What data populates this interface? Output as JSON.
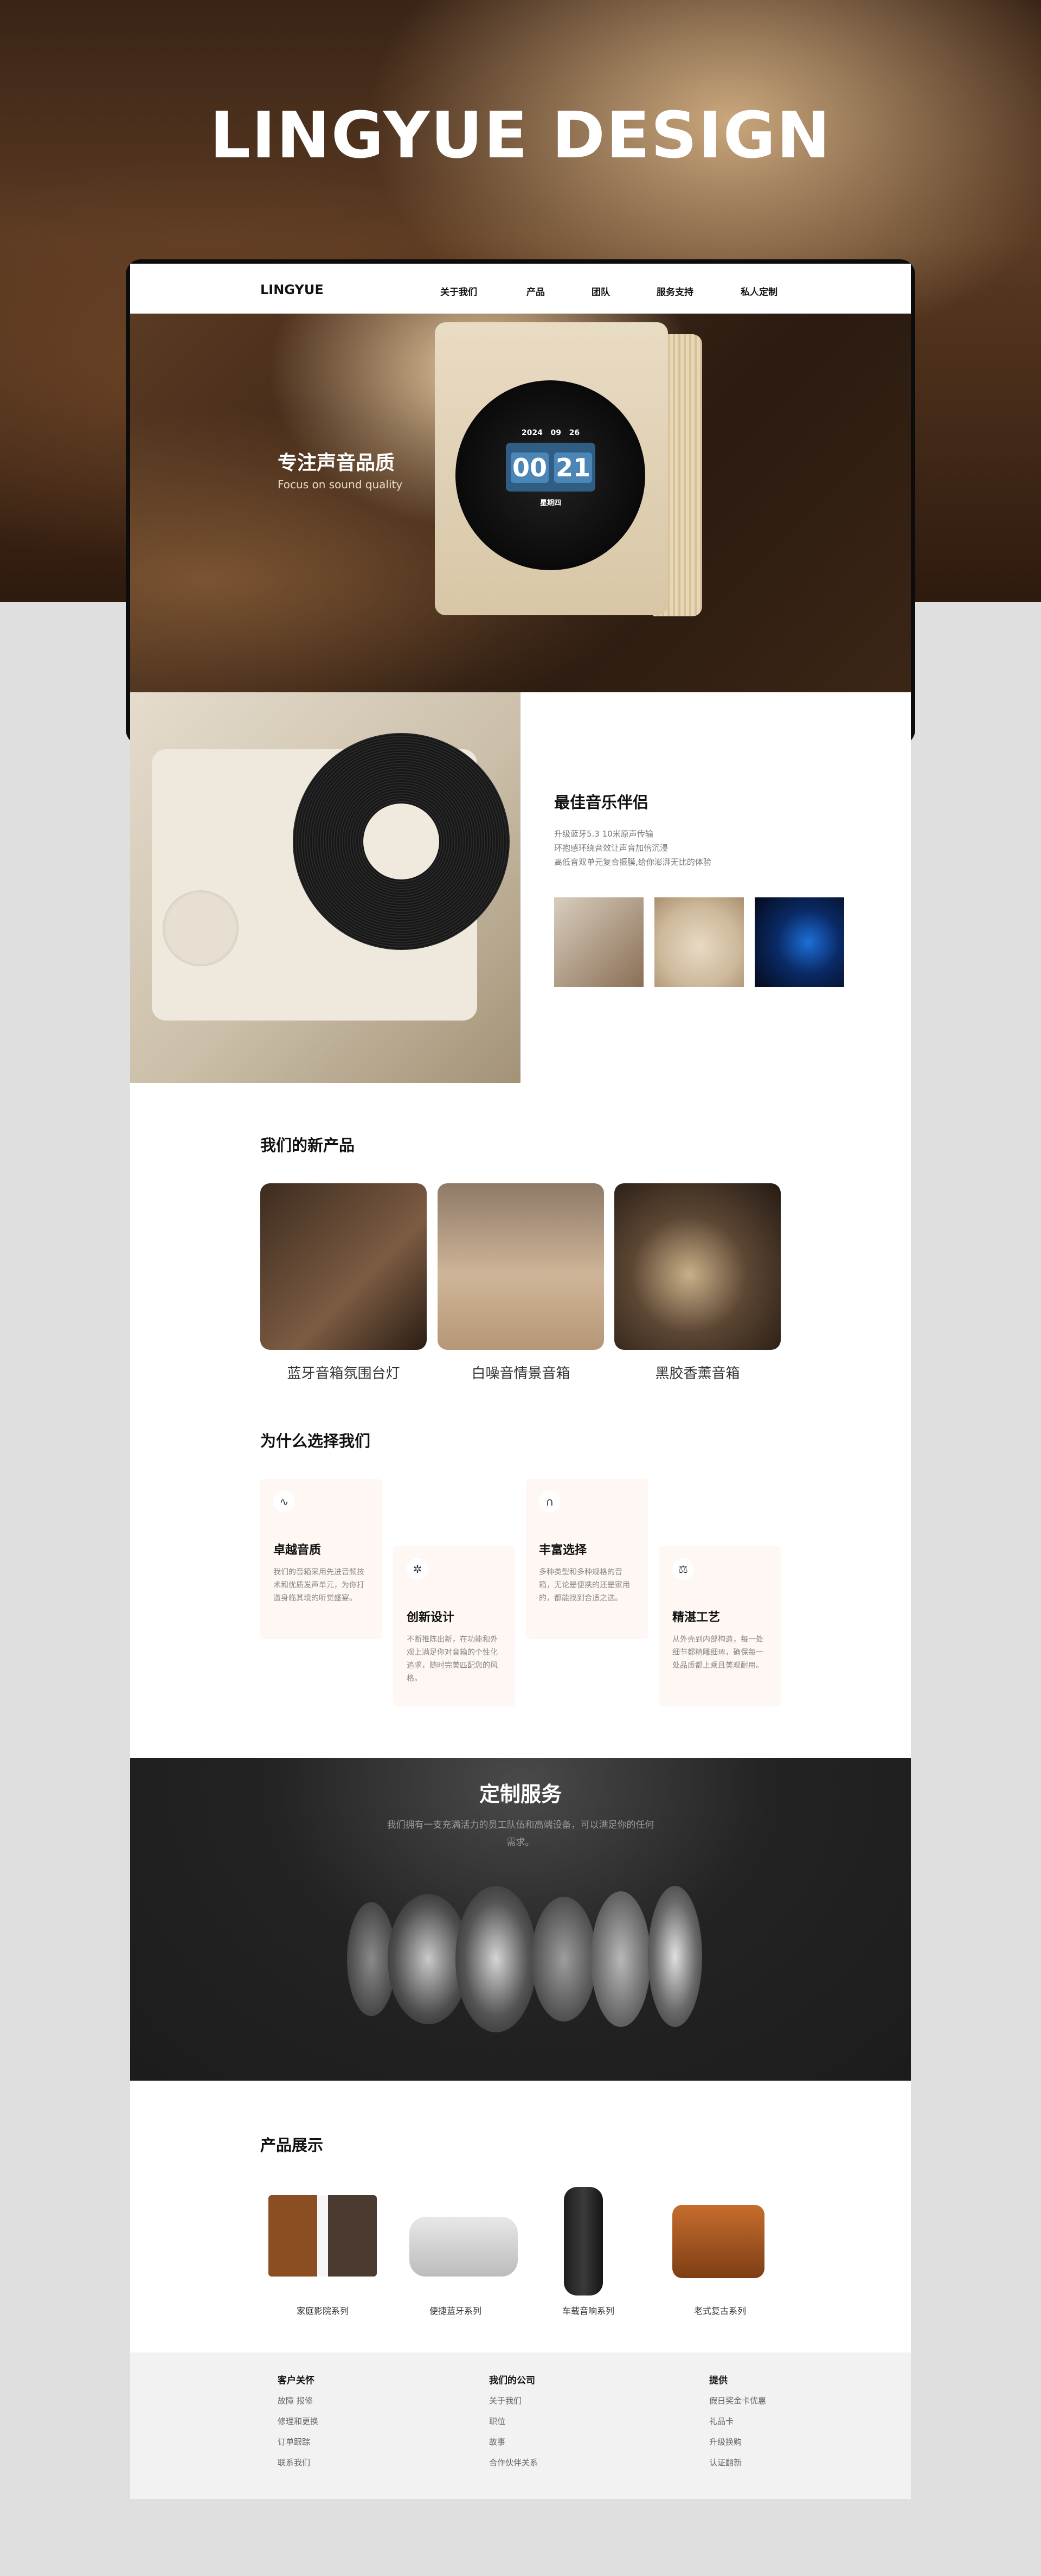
{
  "hero": {
    "title": "LINGYUE DESIGN"
  },
  "nav": {
    "logo": "LINGYUE",
    "items": [
      "关于我们",
      "产品",
      "团队",
      "服务支持",
      "私人定制"
    ]
  },
  "banner": {
    "title": "专注声音品质",
    "subtitle": "Focus on sound quality",
    "clock": {
      "year": "2024",
      "month": "09",
      "day": "26",
      "hour": "00",
      "minute": "21",
      "weekday": "星期四"
    }
  },
  "companion": {
    "title": "最佳音乐伴侣",
    "lines": [
      "升级蓝牙5.3 10米原声传输",
      "环抱感环绕音效让声音加倍沉浸",
      "高低音双单元复合振膜,给你澎湃无比的体验"
    ]
  },
  "new_products": {
    "title": "我们的新产品",
    "items": [
      {
        "label": "蓝牙音箱氛围台灯"
      },
      {
        "label": "白噪音情景音箱"
      },
      {
        "label": "黑胶香薰音箱"
      }
    ]
  },
  "why": {
    "title": "为什么选择我们",
    "cards": [
      {
        "icon": "waveform-icon",
        "head": "卓越音质",
        "body": "我们的音箱采用先进音频技术和优质发声单元，为你打造身临其境的听觉盛宴。"
      },
      {
        "icon": "design-icon",
        "head": "创新设计",
        "body": "不断推陈出新，在功能和外观上满足你对音箱的个性化追求，随时完美匹配您的风格。"
      },
      {
        "icon": "headphone-icon",
        "head": "丰富选择",
        "body": "多种类型和多种规格的音箱，无论是便携的还是家用的，都能找到合适之选。"
      },
      {
        "icon": "balance-icon",
        "head": "精湛工艺",
        "body": "从外壳到内部构造，每一处细节都精雕细琢，确保每一处品质都上乘且美观耐用。"
      }
    ]
  },
  "custom": {
    "title": "定制服务",
    "subtitle": "我们拥有一支充满活力的员工队伍和高端设备，可以满足你的任何需求。"
  },
  "showcase": {
    "title": "产品展示",
    "items": [
      {
        "label": "家庭影院系列"
      },
      {
        "label": "便捷蓝牙系列"
      },
      {
        "label": "车载音响系列"
      },
      {
        "label": "老式复古系列"
      }
    ]
  },
  "footer": {
    "columns": [
      {
        "head": "客户关怀",
        "links": [
          "故障 报修",
          "修理和更换",
          "订单跟踪",
          "联系我们"
        ]
      },
      {
        "head": "我们的公司",
        "links": [
          "关于我们",
          "职位",
          "故事",
          "合作伙伴关系"
        ]
      },
      {
        "head": "提供",
        "links": [
          "假日奖金卡优惠",
          "礼品卡",
          "升级换购",
          "认证翻新"
        ]
      }
    ]
  },
  "colors": {
    "accent_soft": "#fff7f4",
    "dark_section": "#1c1c1c",
    "footer_bg": "#f2f2f2"
  }
}
